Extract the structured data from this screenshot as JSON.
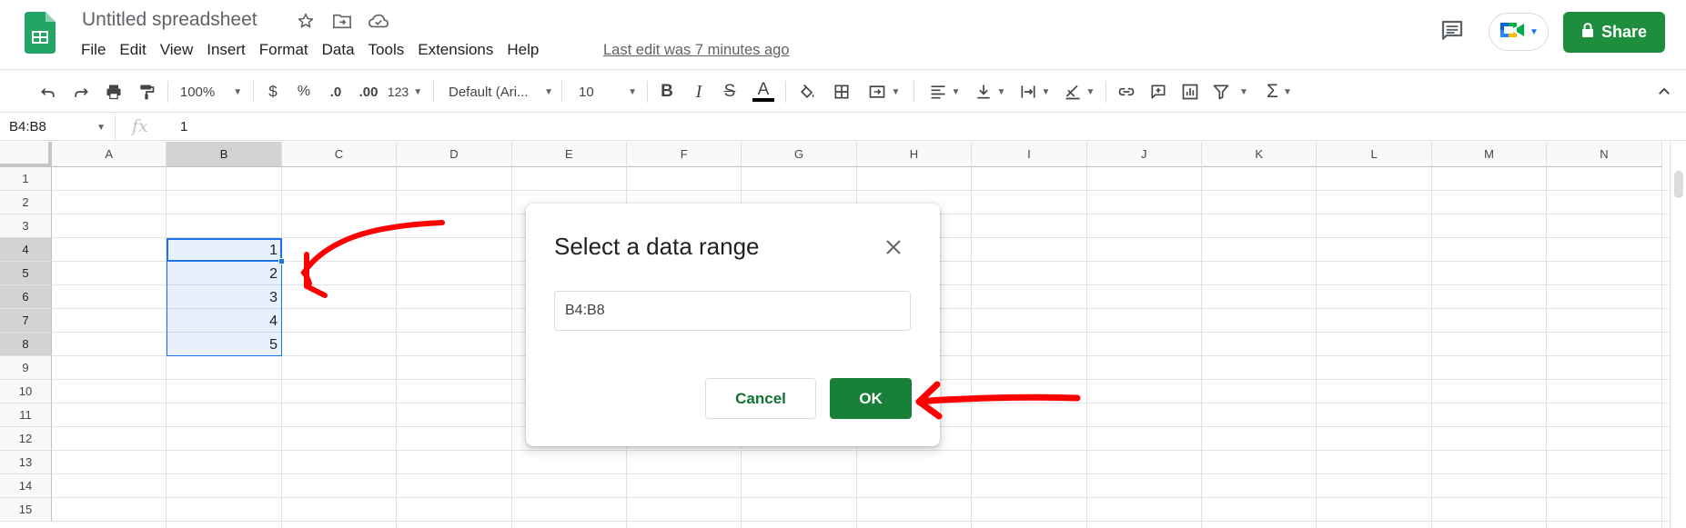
{
  "doc": {
    "title": "Untitled spreadsheet",
    "last_edit": "Last edit was 7 minutes ago"
  },
  "menu": [
    "File",
    "Edit",
    "View",
    "Insert",
    "Format",
    "Data",
    "Tools",
    "Extensions",
    "Help"
  ],
  "share_label": "Share",
  "toolbar": {
    "zoom": "100%",
    "currency": "$",
    "percent": "%",
    "dec_decrease": ".0",
    "dec_increase": ".00",
    "more_formats": "123",
    "font": "Default (Ari...",
    "font_size": "10",
    "bold": "B",
    "italic": "I",
    "strike": "S",
    "text_color": "A",
    "functions": "Σ"
  },
  "formula_bar": {
    "name_box": "B4:B8",
    "fx": "fx",
    "value": "1"
  },
  "grid": {
    "columns": [
      "A",
      "B",
      "C",
      "D",
      "E",
      "F",
      "G",
      "H",
      "I",
      "J",
      "K",
      "L",
      "M",
      "N"
    ],
    "selected_column": "B",
    "rows": [
      "1",
      "2",
      "3",
      "4",
      "5",
      "6",
      "7",
      "8",
      "9",
      "10",
      "11",
      "12",
      "13",
      "14",
      "15"
    ],
    "selected_rows": [
      "4",
      "5",
      "6",
      "7",
      "8"
    ],
    "cells": {
      "B4": "1",
      "B5": "2",
      "B6": "3",
      "B7": "4",
      "B8": "5"
    }
  },
  "dialog": {
    "title": "Select a data range",
    "range_value": "B4:B8",
    "cancel_label": "Cancel",
    "ok_label": "OK"
  },
  "colors": {
    "brand_green": "#188038",
    "selection_blue": "#1a73e8",
    "annotation_red": "#ff0000"
  }
}
